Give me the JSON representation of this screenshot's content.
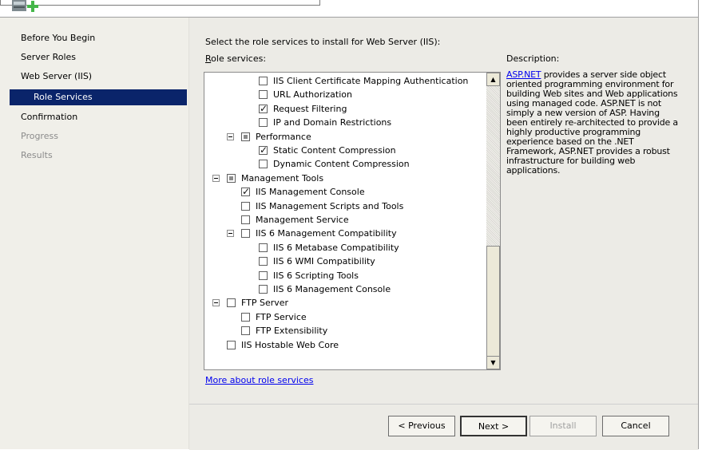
{
  "header": {
    "icon": "server-role-icon"
  },
  "nav": {
    "items": [
      {
        "label": "Before You Begin",
        "state": "normal"
      },
      {
        "label": "Server Roles",
        "state": "normal"
      },
      {
        "label": "Web Server (IIS)",
        "state": "normal"
      },
      {
        "label": "Role Services",
        "state": "selected"
      },
      {
        "label": "Confirmation",
        "state": "normal"
      },
      {
        "label": "Progress",
        "state": "disabled"
      },
      {
        "label": "Results",
        "state": "disabled"
      }
    ]
  },
  "content": {
    "instruction": "Select the role services to install for Web Server (IIS):",
    "role_services_label_first": "R",
    "role_services_label_rest": "ole services:",
    "description_label": "Description:",
    "description_link": "ASP.NET",
    "description_text": " provides a server side object oriented programming environment for building Web sites and Web applications using managed code. ASP.NET is not simply a new version of ASP. Having been entirely re-architected to provide a highly productive programming experience based on the .NET Framework, ASP.NET provides a robust infrastructure for building web applications.",
    "more_link": "More about role services"
  },
  "tree": [
    {
      "label": "IIS Client Certificate Mapping Authentication",
      "state": "unchecked",
      "level": 3,
      "toggle": false
    },
    {
      "label": "URL Authorization",
      "state": "unchecked",
      "level": 3,
      "toggle": false
    },
    {
      "label": "Request Filtering",
      "state": "checked",
      "level": 3,
      "toggle": false
    },
    {
      "label": "IP and Domain Restrictions",
      "state": "unchecked",
      "level": 3,
      "toggle": false
    },
    {
      "label": "Performance",
      "state": "partial",
      "level": 2,
      "toggle": true
    },
    {
      "label": "Static Content Compression",
      "state": "checked",
      "level": 3,
      "toggle": false
    },
    {
      "label": "Dynamic Content Compression",
      "state": "unchecked",
      "level": 3,
      "toggle": false
    },
    {
      "label": "Management Tools",
      "state": "partial",
      "level": 1,
      "toggle": true
    },
    {
      "label": "IIS Management Console",
      "state": "checked",
      "level": 2,
      "toggle": false
    },
    {
      "label": "IIS Management Scripts and Tools",
      "state": "unchecked",
      "level": 2,
      "toggle": false
    },
    {
      "label": "Management Service",
      "state": "unchecked",
      "level": 2,
      "toggle": false
    },
    {
      "label": "IIS 6 Management Compatibility",
      "state": "unchecked",
      "level": 2,
      "toggle": true
    },
    {
      "label": "IIS 6 Metabase Compatibility",
      "state": "unchecked",
      "level": 3,
      "toggle": false
    },
    {
      "label": "IIS 6 WMI Compatibility",
      "state": "unchecked",
      "level": 3,
      "toggle": false
    },
    {
      "label": "IIS 6 Scripting Tools",
      "state": "unchecked",
      "level": 3,
      "toggle": false
    },
    {
      "label": "IIS 6 Management Console",
      "state": "unchecked",
      "level": 3,
      "toggle": false
    },
    {
      "label": "FTP Server",
      "state": "unchecked",
      "level": 1,
      "toggle": true
    },
    {
      "label": "FTP Service",
      "state": "unchecked",
      "level": 2,
      "toggle": false
    },
    {
      "label": "FTP Extensibility",
      "state": "unchecked",
      "level": 2,
      "toggle": false
    },
    {
      "label": "IIS Hostable Web Core",
      "state": "unchecked",
      "level": 1,
      "toggle": false
    }
  ],
  "scroll": {
    "up_icon": "scroll-up-arrow-icon",
    "down_icon": "scroll-down-arrow-icon"
  },
  "buttons": {
    "previous": "< Previous",
    "next": "Next >",
    "install": "Install",
    "cancel": "Cancel"
  }
}
